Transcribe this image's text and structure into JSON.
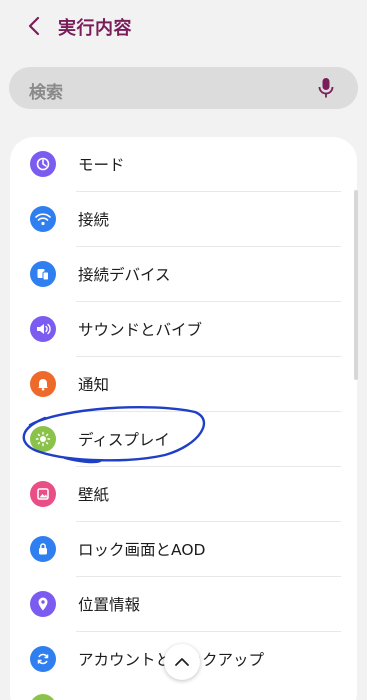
{
  "header": {
    "back_icon": "chevron-left-icon",
    "title": "実行内容",
    "title_color": "#7a1e5a"
  },
  "search": {
    "placeholder": "検索",
    "mic_icon": "microphone-icon"
  },
  "settings": [
    {
      "label": "モード",
      "icon": "modes-icon",
      "color": "#7c5cf0"
    },
    {
      "label": "接続",
      "icon": "wifi-icon",
      "color": "#2f7ff0"
    },
    {
      "label": "接続デバイス",
      "icon": "connected-devices-icon",
      "color": "#2f7ff0"
    },
    {
      "label": "サウンドとバイブ",
      "icon": "sound-icon",
      "color": "#7c5cf0"
    },
    {
      "label": "通知",
      "icon": "bell-icon",
      "color": "#ee6a2a"
    },
    {
      "label": "ディスプレイ",
      "icon": "brightness-icon",
      "color": "#8bc34a"
    },
    {
      "label": "壁紙",
      "icon": "wallpaper-icon",
      "color": "#e94f86"
    },
    {
      "label": "ロック画面とAOD",
      "icon": "lock-icon",
      "color": "#2f7ff0"
    },
    {
      "label": "位置情報",
      "icon": "location-icon",
      "color": "#7c5cf0"
    },
    {
      "label": "アカウントとバックアップ",
      "icon": "sync-icon",
      "color": "#2f7ff0"
    }
  ],
  "scroll_up_icon": "chevron-up-icon",
  "annotation_color": "#1f3fc4"
}
